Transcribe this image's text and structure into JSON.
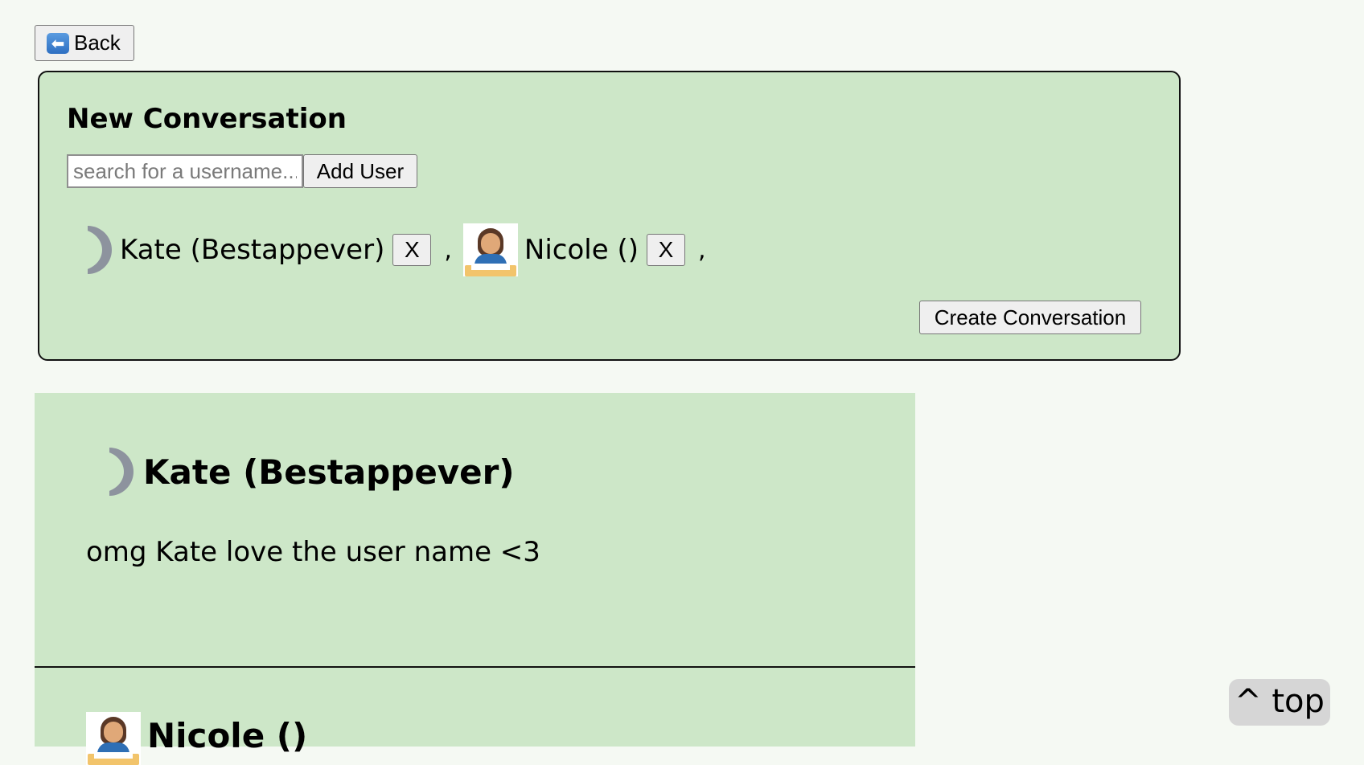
{
  "nav": {
    "back_label": "Back"
  },
  "new_conversation": {
    "title": "New Conversation",
    "search_placeholder": "search for a username...",
    "add_user_label": "Add User",
    "selected_users": [
      {
        "name": "Kate (Bestappever)",
        "avatar": "moon-icon",
        "remove_label": "X"
      },
      {
        "name": "Nicole ()",
        "avatar": "woman-reading-emoji",
        "remove_label": "X"
      }
    ],
    "separator": ",",
    "create_label": "Create Conversation"
  },
  "conversations": [
    {
      "name": "Kate (Bestappever)",
      "avatar": "moon-icon",
      "last_message": "omg Kate love the user name <3"
    },
    {
      "name": "Nicole ()",
      "avatar": "woman-reading-emoji",
      "last_message": ""
    }
  ],
  "scroll_top_label": "^ top",
  "colors": {
    "panel": "#cde7c8",
    "background": "#f5f9f3",
    "button": "#efefef",
    "moon": "#8d939e"
  }
}
